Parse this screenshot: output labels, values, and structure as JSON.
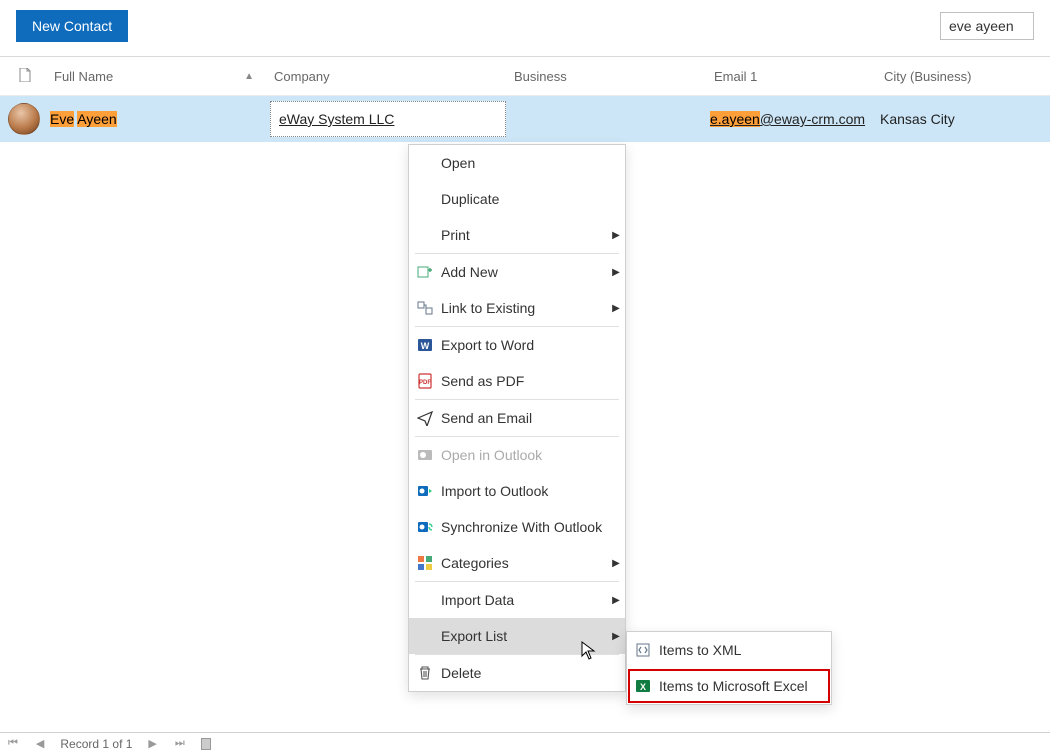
{
  "toolbar": {
    "new_contact": "New Contact",
    "search_value": "eve ayeen"
  },
  "columns": {
    "full_name": "Full Name",
    "company": "Company",
    "business": "Business",
    "email1": "Email 1",
    "city": "City (Business)"
  },
  "row": {
    "name_first": "Eve",
    "name_last": "Ayeen",
    "company": "eWay System LLC",
    "email_highlight": "e.ayeen",
    "email_rest": "@eway-crm.com",
    "city": "Kansas City"
  },
  "ctx": {
    "open": "Open",
    "duplicate": "Duplicate",
    "print": "Print",
    "add_new": "Add New",
    "link_existing": "Link to Existing",
    "export_word": "Export to Word",
    "send_pdf": "Send as PDF",
    "send_email": "Send an Email",
    "open_outlook": "Open in Outlook",
    "import_outlook": "Import to Outlook",
    "sync_outlook": "Synchronize With Outlook",
    "categories": "Categories",
    "import_data": "Import Data",
    "export_list": "Export List",
    "delete": "Delete"
  },
  "sub": {
    "xml": "Items to XML",
    "excel": "Items to Microsoft Excel"
  },
  "footer": {
    "record": "Record 1 of 1"
  }
}
